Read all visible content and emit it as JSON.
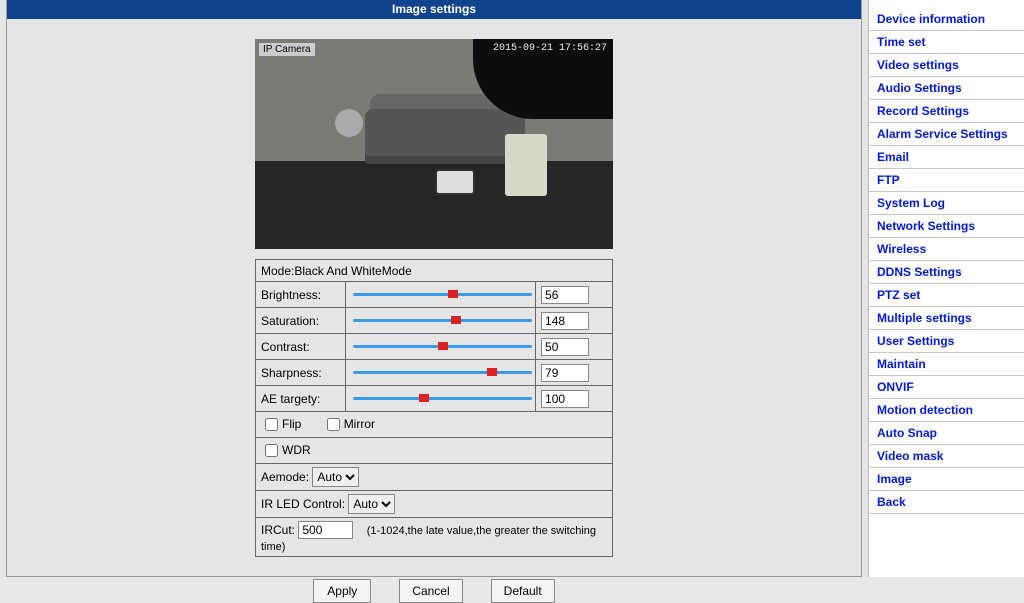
{
  "title": "Image settings",
  "preview": {
    "label": "IP Camera",
    "timestamp": "2015-09-21 17:56:27"
  },
  "mode_row": "Mode:Black And WhiteMode",
  "sliders": {
    "brightness": {
      "label": "Brightness:",
      "value": "56"
    },
    "saturation": {
      "label": "Saturation:",
      "value": "148"
    },
    "contrast": {
      "label": "Contrast:",
      "value": "50"
    },
    "sharpness": {
      "label": "Sharpness:",
      "value": "79"
    },
    "ae_targety": {
      "label": "AE targety:",
      "value": "100"
    }
  },
  "checks": {
    "flip": "Flip",
    "mirror": "Mirror",
    "wdr": "WDR"
  },
  "aemode": {
    "label": "Aemode:",
    "selected": "Auto"
  },
  "irled": {
    "label": "IR LED Control:",
    "selected": "Auto"
  },
  "ircut": {
    "label": "IRCut:",
    "value": "500",
    "hint": "(1-1024,the late value,the greater the switching time)"
  },
  "buttons": {
    "apply": "Apply",
    "cancel": "Cancel",
    "default": "Default"
  },
  "nav": [
    "Device information",
    "Time set",
    "Video settings",
    "Audio Settings",
    "Record Settings",
    "Alarm Service Settings",
    "Email",
    "FTP",
    "System Log",
    "Network Settings",
    "Wireless",
    "DDNS Settings",
    "PTZ set",
    "Multiple settings",
    "User Settings",
    "Maintain",
    "ONVIF",
    "Motion detection",
    "Auto Snap",
    "Video mask",
    "Image",
    "Back"
  ]
}
